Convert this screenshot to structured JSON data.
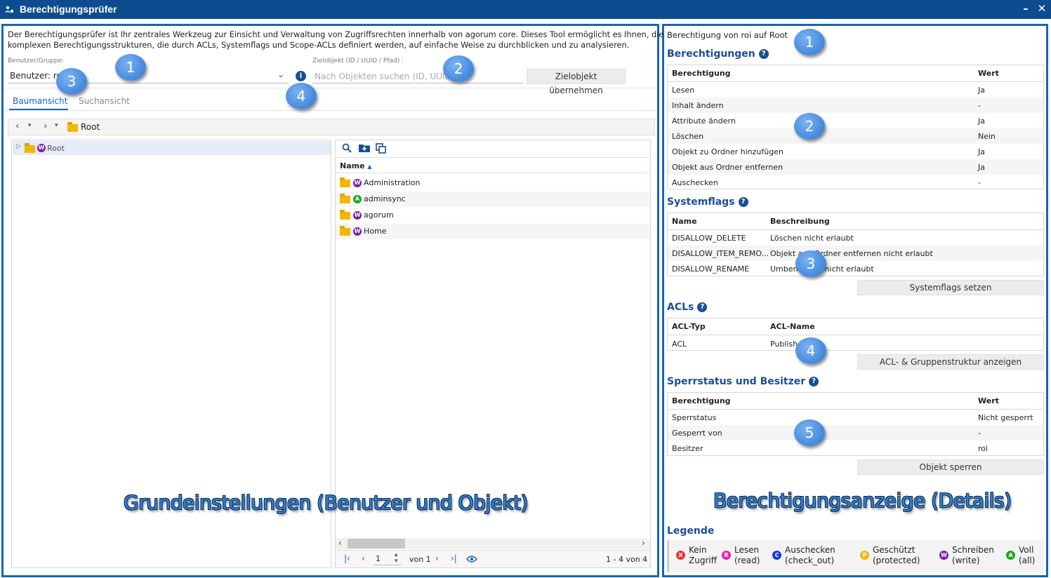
{
  "window": {
    "title": "Berechtigungsprüfer",
    "min_icon": "minimize-icon",
    "close_icon": "close-icon"
  },
  "left": {
    "description_line1": "Der Berechtigungsprüfer ist Ihr zentrales Werkzeug zur Einsicht und Verwaltung von Zugriffsrechten innerhalb von agorum core. Dieses Tool ermöglicht es Ihnen, die",
    "description_line2": "komplexen Berechtigungsstrukturen, die durch ACLs, Systemflags und Scope-ACLs definiert werden, auf einfache Weise zu durchblicken und zu analysieren.",
    "user_label": "Benutzer/Gruppe:",
    "user_value": "Benutzer: roi",
    "target_label": "Zielobjekt (ID / UUID / Pfad) :",
    "target_placeholder": "Nach Objekten suchen (ID, UUID,",
    "target_button": "Zielobjekt übernehmen",
    "tabs": [
      "Baumansicht",
      "Suchansicht"
    ],
    "breadcrumb": "Root",
    "tree_root": "Root",
    "list_header": "Name",
    "list_items": [
      {
        "name": "Administration",
        "badge": "W",
        "badge_color": "#7b1fa2"
      },
      {
        "name": "adminsync",
        "badge": "A",
        "badge_color": "#1fa51f"
      },
      {
        "name": "agorum",
        "badge": "W",
        "badge_color": "#7b1fa2"
      },
      {
        "name": "Home",
        "badge": "W",
        "badge_color": "#7b1fa2"
      }
    ],
    "pager": {
      "page": "1",
      "of_label": "von 1",
      "range": "1 - 4 von 4"
    },
    "caption": "Grundeinstellungen (Benutzer und Objekt)"
  },
  "right": {
    "heading": "Berechtigung von roi auf Root",
    "permissions": {
      "title": "Berechtigungen",
      "col1": "Berechtigung",
      "col2": "Wert",
      "rows": [
        [
          "Lesen",
          "Ja"
        ],
        [
          "Inhalt ändern",
          "-"
        ],
        [
          "Attribute ändern",
          "Ja"
        ],
        [
          "Löschen",
          "Nein"
        ],
        [
          "Objekt zu Ordner hinzufügen",
          "Ja"
        ],
        [
          "Objekt aus Ordner entfernen",
          "Ja"
        ],
        [
          "Auschecken",
          "-"
        ]
      ]
    },
    "systemflags": {
      "title": "Systemflags",
      "col1": "Name",
      "col2": "Beschreibung",
      "rows": [
        [
          "DISALLOW_DELETE",
          "Löschen nicht erlaubt"
        ],
        [
          "DISALLOW_ITEM_REMO...",
          "Objekt aus Ordner entfernen nicht erlaubt"
        ],
        [
          "DISALLOW_RENAME",
          "Umbenennen nicht erlaubt"
        ]
      ],
      "button": "Systemflags setzen"
    },
    "acls": {
      "title": "ACLs",
      "col1": "ACL-Typ",
      "col2": "ACL-Name",
      "rows": [
        [
          "ACL",
          "Publisher"
        ]
      ],
      "button": "ACL- & Gruppenstruktur anzeigen"
    },
    "lock": {
      "title": "Sperrstatus und Besitzer",
      "col1": "Berechtigung",
      "col2": "Wert",
      "rows": [
        [
          "Sperrstatus",
          "Nicht gesperrt"
        ],
        [
          "Gesperrt von",
          "-"
        ],
        [
          "Besitzer",
          "roi"
        ]
      ],
      "button": "Objekt sperren"
    },
    "caption": "Berechtigungsanzeige (Details)",
    "legend": {
      "title": "Legende",
      "items": [
        {
          "badge": "X",
          "color": "#e53935",
          "l1": "Kein",
          "l2": "Zugriff"
        },
        {
          "badge": "R",
          "color": "#ec1fb0",
          "l1": "Lesen",
          "l2": "(read)"
        },
        {
          "badge": "C",
          "color": "#1a3ad8",
          "l1": "Auschecken",
          "l2": "(check_out)"
        },
        {
          "badge": "P",
          "color": "#f2b705",
          "l1": "Geschützt",
          "l2": "(protected)"
        },
        {
          "badge": "W",
          "color": "#7b1fa2",
          "l1": "Schreiben",
          "l2": "(write)"
        },
        {
          "badge": "A",
          "color": "#1fa51f",
          "l1": "Voll",
          "l2": "(all)"
        }
      ]
    }
  },
  "callouts_left": [
    "1",
    "2",
    "3",
    "4"
  ],
  "callouts_right": [
    "1",
    "2",
    "3",
    "4",
    "5"
  ]
}
